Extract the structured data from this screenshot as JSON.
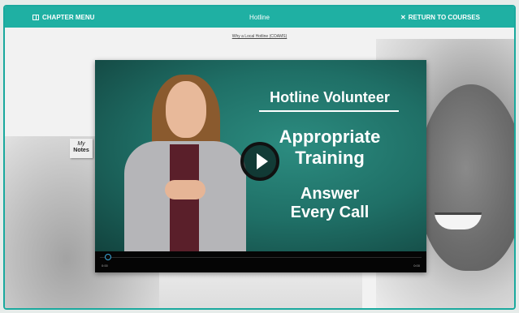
{
  "header": {
    "menu_label": "CHAPTER MENU",
    "title": "Hotline",
    "return_label": "RETURN TO COURSES",
    "return_icon": "✕"
  },
  "subtitle": "Why a Local Hotline (COAMS)",
  "notes": {
    "line1": "My",
    "line2": "Notes"
  },
  "video": {
    "heading": "Hotline Volunteer",
    "line2a": "Appropriate",
    "line2b": "Training",
    "line3a": "Answer",
    "line3b": "Every Call",
    "time_current": "0:00",
    "time_total": "0:00",
    "progress": 0.01
  },
  "colors": {
    "accent": "#1fb0a3",
    "progress": "#3aa6d8"
  }
}
